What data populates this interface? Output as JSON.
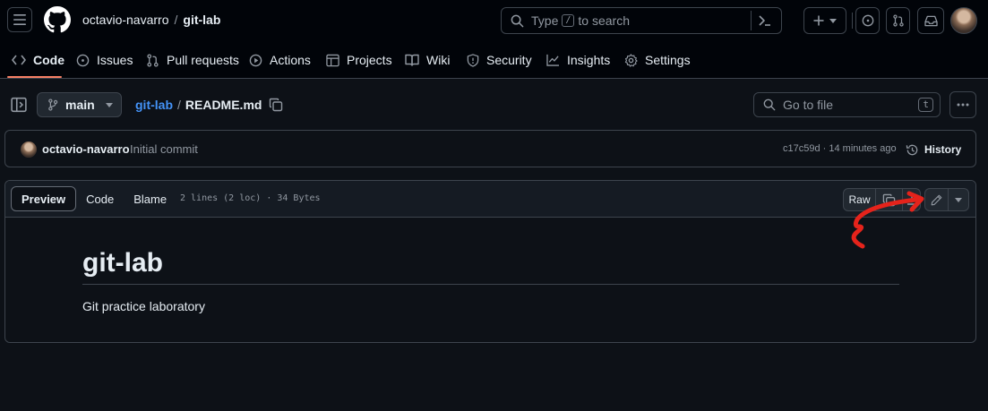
{
  "header": {
    "owner": "octavio-navarro",
    "separator": "/",
    "repo": "git-lab",
    "search": {
      "prefix": "Type",
      "key": "/",
      "suffix": "to search"
    }
  },
  "repo_nav": {
    "tabs": [
      {
        "label": "Code",
        "icon": "code-icon"
      },
      {
        "label": "Issues",
        "icon": "issue-icon"
      },
      {
        "label": "Pull requests",
        "icon": "pull-request-icon"
      },
      {
        "label": "Actions",
        "icon": "play-icon"
      },
      {
        "label": "Projects",
        "icon": "table-icon"
      },
      {
        "label": "Wiki",
        "icon": "book-icon"
      },
      {
        "label": "Security",
        "icon": "shield-icon"
      },
      {
        "label": "Insights",
        "icon": "graph-icon"
      },
      {
        "label": "Settings",
        "icon": "gear-icon"
      }
    ],
    "active": "Code"
  },
  "file_header": {
    "branch": "main",
    "path_repo": "git-lab",
    "path_sep": "/",
    "path_file": "README.md",
    "goto_placeholder": "Go to file",
    "goto_key": "t"
  },
  "commit": {
    "author": "octavio-navarro",
    "message": "Initial commit",
    "meta": "c17c59d · 14 minutes ago",
    "history_label": "History"
  },
  "file_toolbar": {
    "tabs": [
      "Preview",
      "Code",
      "Blame"
    ],
    "active": "Preview",
    "info": "2 lines (2 loc) · 34 Bytes",
    "raw_label": "Raw"
  },
  "readme": {
    "heading": "git-lab",
    "body": "Git practice laboratory"
  },
  "colors": {
    "background": "#0d1117",
    "header": "#010409",
    "accent_underline": "#f78166",
    "link": "#4493f8",
    "annotation": "#e5231b"
  }
}
